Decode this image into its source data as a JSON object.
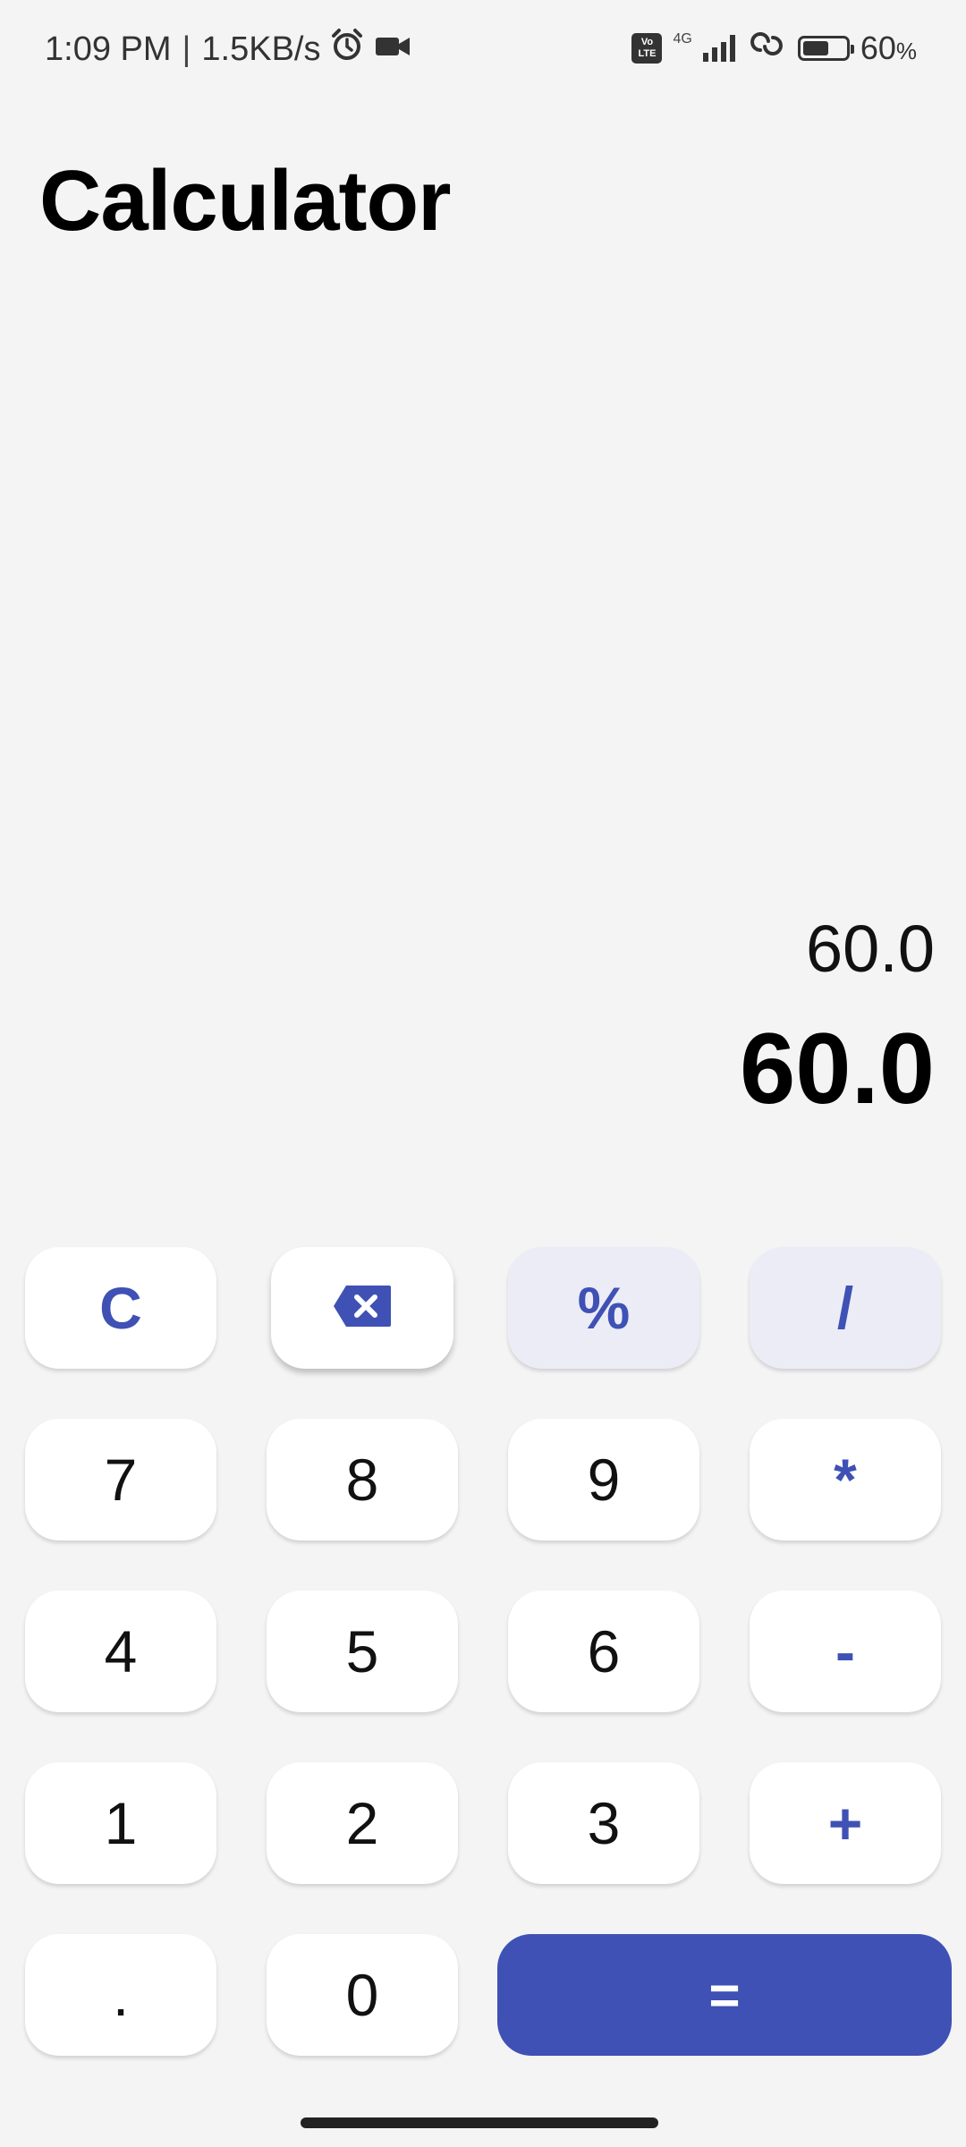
{
  "status_bar": {
    "time": "1:09 PM",
    "separator": "|",
    "network_speed": "1.5KB/s",
    "network_type": "4G",
    "volte_top": "Vo",
    "volte_bottom": "LTE",
    "battery_level": "60",
    "battery_unit": "%",
    "battery_fraction": 0.6,
    "icons": [
      "alarm-icon",
      "video-camera-icon",
      "volte-icon",
      "signal-icon",
      "hotspot-icon",
      "battery-icon"
    ]
  },
  "title": "Calculator",
  "display": {
    "expression": "60.0",
    "result": "60.0"
  },
  "keypad": {
    "clear": "C",
    "backspace_icon": "backspace-icon",
    "percent": "%",
    "divide": "/",
    "seven": "7",
    "eight": "8",
    "nine": "9",
    "multiply": "*",
    "four": "4",
    "five": "5",
    "six": "6",
    "subtract": "-",
    "one": "1",
    "two": "2",
    "three": "3",
    "add": "+",
    "decimal": ".",
    "zero": "0",
    "equals": "="
  },
  "colors": {
    "accent": "#3f51b5",
    "background": "#f4f4f5",
    "key": "#ffffff",
    "key_tint": "#ececf6"
  }
}
